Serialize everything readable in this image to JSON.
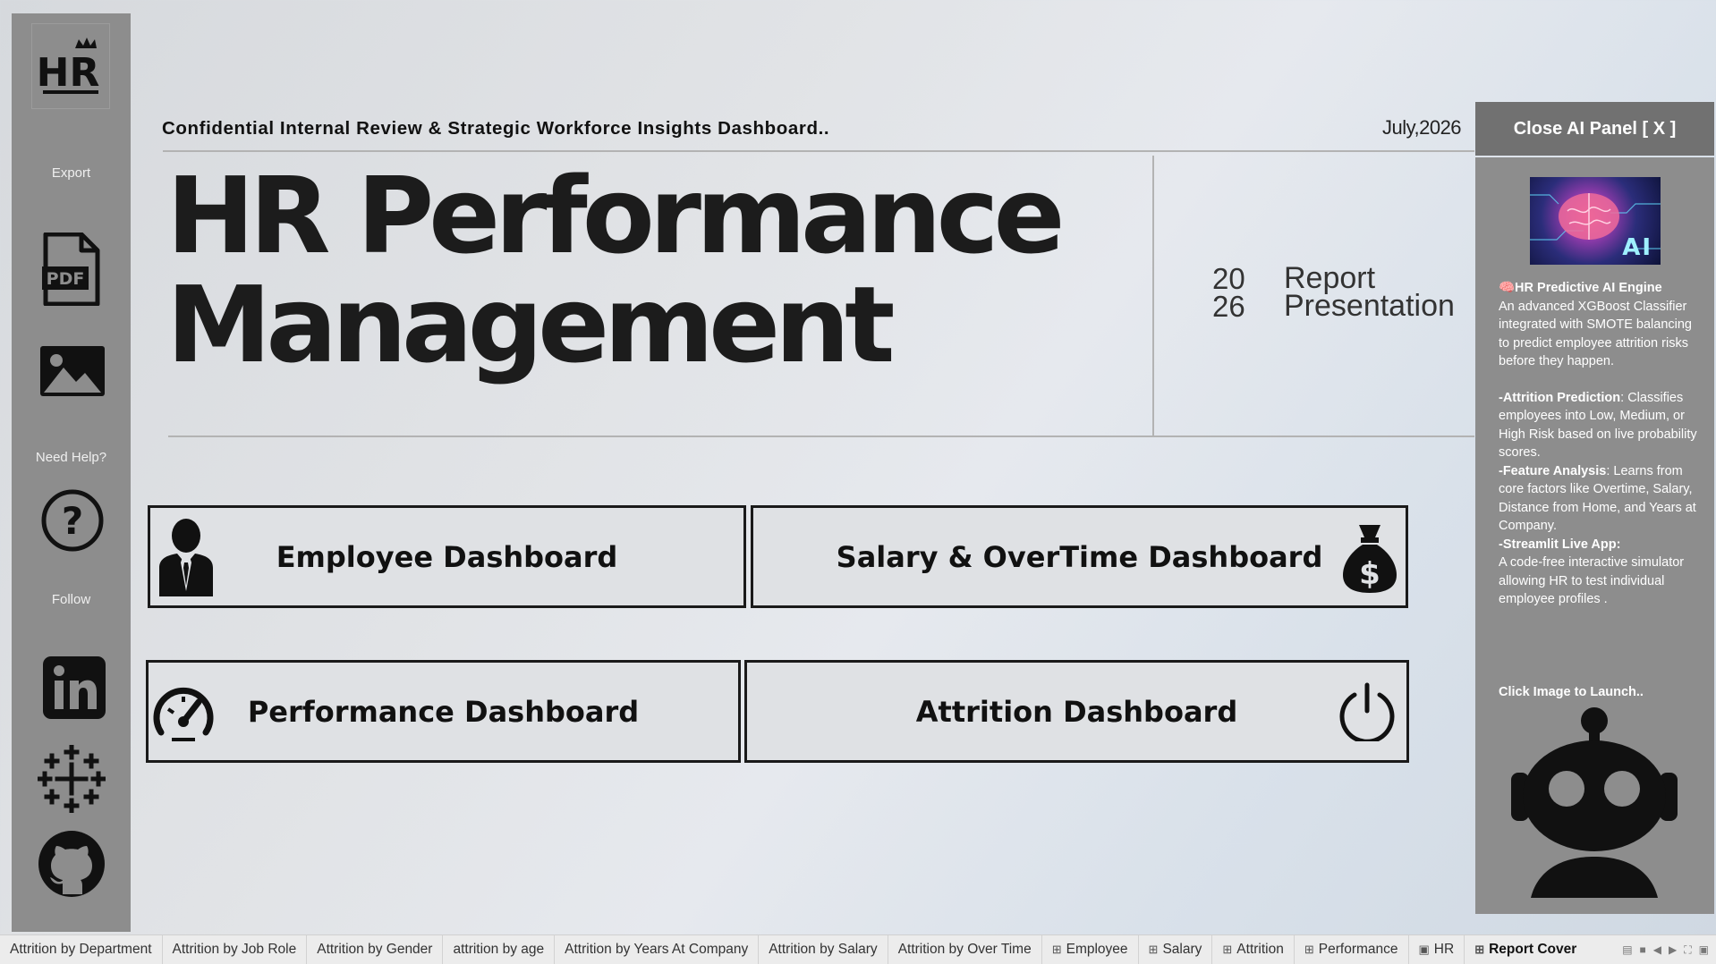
{
  "sidebar": {
    "logo_text": "HR",
    "export_label": "Export",
    "pdf_text": "PDF",
    "help_label": "Need Help?",
    "follow_label": "Follow",
    "icons": [
      "hr-crown-logo",
      "pdf-icon",
      "image-icon",
      "help-icon",
      "linkedin-icon",
      "tableau-icon",
      "github-icon"
    ]
  },
  "header": {
    "subtitle": "Confidential Internal Review & Strategic Workforce Insights Dashboard..",
    "date": "July,2026"
  },
  "title": {
    "line1": "HR Performance",
    "line2": "Management"
  },
  "report": {
    "year_top": "20",
    "year_bottom": "26",
    "label_line1": "Report",
    "label_line2": "Presentation"
  },
  "dashboards": {
    "employee": "Employee Dashboard",
    "salary": "Salary & OverTime Dashboard",
    "performance": "Performance Dashboard",
    "attrition": "Attrition Dashboard"
  },
  "ai_panel": {
    "close_label": "Close AI Panel [ X ]",
    "image_text": "AI",
    "engine_title": "🧠HR Predictive AI Engine",
    "engine_desc": "An advanced XGBoost Classifier integrated with SMOTE balancing to predict employee attrition risks before they happen.",
    "attrition_head": "-Attrition Prediction",
    "attrition_desc": ": Classifies employees into Low, Medium, or High Risk based on live probability scores.",
    "feature_head": "-Feature Analysis",
    "feature_desc": ": Learns from core factors like Overtime, Salary, Distance from Home, and Years at Company.",
    "streamlit_head": "-Streamlit Live App:",
    "streamlit_desc": " A code-free interactive simulator allowing HR to test individual employee profiles .",
    "launch_hint": "Click Image to Launch..",
    "accent": "#717171",
    "panel_bg": "#8d8d8d"
  },
  "tabs": {
    "t1": "Attrition by Department",
    "t2": "Attrition by Job Role",
    "t3": "Attrition by Gender",
    "t4": "attrition by age",
    "t5": "Attrition by Years At Company",
    "t6": "Attrition by Salary",
    "t7": "Attrition by Over Time",
    "t8": "Employee",
    "t9": "Salary",
    "t10": "Attrition",
    "t11": "Performance",
    "t12": "HR",
    "t13": "Report Cover",
    "dashboard_glyph": "⊞"
  }
}
